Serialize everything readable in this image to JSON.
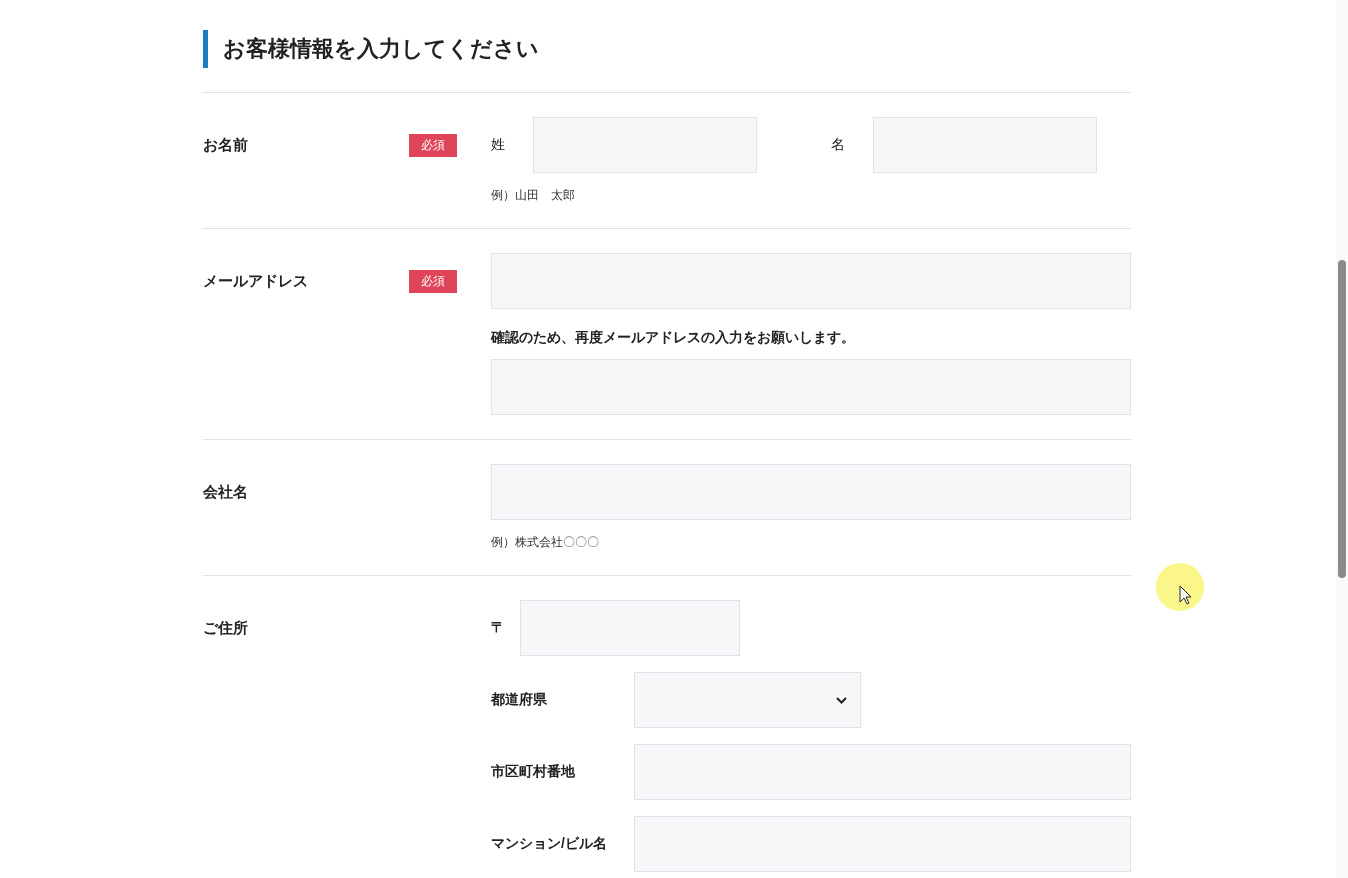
{
  "heading": "お客様情報を入力してください",
  "sections": [
    {
      "label": "お名前",
      "badge": "必須",
      "fields": [
        {
          "kind": "name_pair",
          "parts": [
            {
              "label": "姓"
            },
            {
              "label": "名"
            }
          ]
        },
        {
          "kind": "hint",
          "text": "例）山田　太郎"
        }
      ]
    },
    {
      "label": "メールアドレス",
      "badge": "必須",
      "fields": [
        {
          "kind": "input"
        },
        {
          "kind": "note",
          "text": "確認のため、再度メールアドレスの入力をお願いします。"
        },
        {
          "kind": "input"
        }
      ]
    },
    {
      "label": "会社名",
      "fields": [
        {
          "kind": "input"
        },
        {
          "kind": "hint",
          "text": "例）株式会社〇〇〇"
        }
      ]
    },
    {
      "label": "ご住所",
      "fields": [
        {
          "kind": "postal",
          "label": "〒"
        },
        {
          "kind": "labeled_select",
          "label": "都道府県"
        },
        {
          "kind": "labeled_input",
          "label": "市区町村番地"
        },
        {
          "kind": "labeled_input",
          "label": "マンション/ビル名"
        }
      ]
    }
  ]
}
